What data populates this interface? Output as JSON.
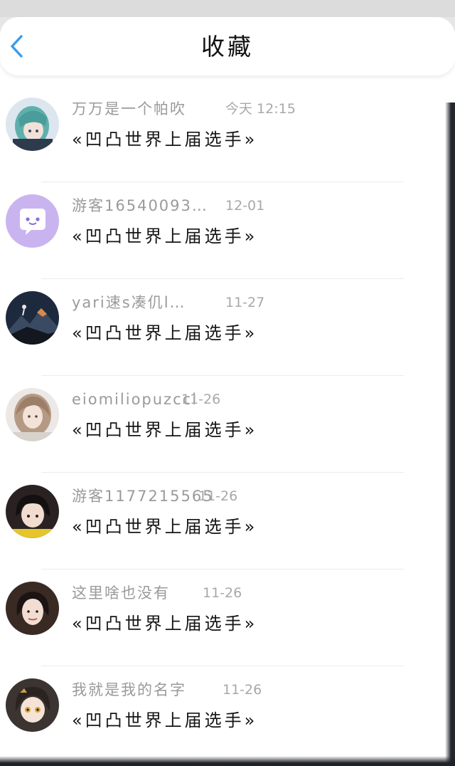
{
  "header": {
    "title": "收藏",
    "back_icon": "chevron-left-icon",
    "accent_color": "#3a9bea"
  },
  "favorites": [
    {
      "username": "万万是一个帕吹",
      "time": "今天 12:15",
      "title": "«凹凸世界上届选手»",
      "avatar": "anime-teal-hair-avatar"
    },
    {
      "username": "游客16540093…",
      "time": "12-01",
      "title": "«凹凸世界上届选手»",
      "avatar": "default-chat-bubble-avatar"
    },
    {
      "username": "yari速s凑仉l…",
      "time": "11-27",
      "title": "«凹凸世界上届选手»",
      "avatar": "climber-mountain-avatar"
    },
    {
      "username": "eiomiliopuzcci",
      "time": "11-26",
      "title": "«凹凸世界上届选手»",
      "avatar": "girl-wavy-hair-avatar"
    },
    {
      "username": "游客1177215565",
      "time": "11-26",
      "title": "«凹凸世界上届选手»",
      "avatar": "girl-bangs-avatar"
    },
    {
      "username": "这里啥也没有",
      "time": "11-26",
      "title": "«凹凸世界上届选手»",
      "avatar": "girl-portrait-avatar"
    },
    {
      "username": "我就是我的名字",
      "time": "11-26",
      "title": "«凹凸世界上届选手»",
      "avatar": "anime-gold-eyes-avatar"
    }
  ]
}
